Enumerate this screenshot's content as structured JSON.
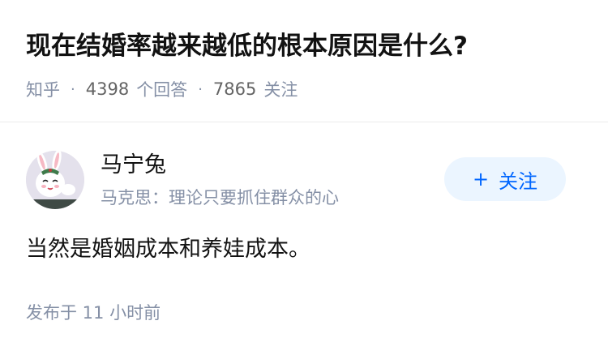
{
  "question": {
    "title": "现在结婚率越来越低的根本原因是什么?"
  },
  "meta": {
    "source": "知乎",
    "separator": "·",
    "answers_count": "4398",
    "answers_label": "个回答",
    "followers_count": "7865",
    "followers_label": "关注"
  },
  "author": {
    "name": "马宁兔",
    "bio": "马克思：理论只要抓住群众的心",
    "avatar_icon": "rabbit-avatar-icon"
  },
  "follow_button": {
    "plus": "+",
    "label": "关注"
  },
  "answer": {
    "text": "当然是婚姻成本和养娃成本。",
    "published": "发布于 11 小时前"
  },
  "colors": {
    "accent": "#0066ff",
    "accent_bg": "#ebf5ff",
    "muted_text": "#8590a6",
    "primary_text": "#121212"
  }
}
